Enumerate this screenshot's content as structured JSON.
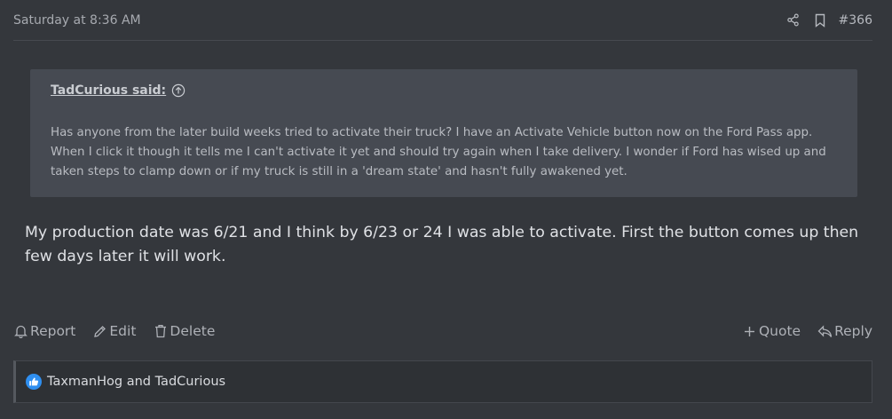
{
  "post": {
    "timestamp": "Saturday at 8:36 AM",
    "number": "#366",
    "share_icon": "share-icon",
    "bookmark_icon": "bookmark-icon"
  },
  "quote": {
    "author_label": "TadCurious said:",
    "jump_icon": "arrow-up-circle-icon",
    "text": "Has anyone from the later build weeks tried to activate their truck? I have an Activate Vehicle button now on the Ford Pass app. When I click it though it tells me I can't activate it yet and should try again when I take delivery. I wonder if Ford has wised up and taken steps to clamp down or if my truck is still in a 'dream state' and hasn't fully awakened yet."
  },
  "message": {
    "text": "My production date was 6/21 and I think by 6/23 or 24 I was able to activate. First the button comes up then few days later it will work."
  },
  "actions": {
    "report": "Report",
    "edit": "Edit",
    "delete": "Delete",
    "quote": "Quote",
    "reply": "Reply"
  },
  "reactions": {
    "icon": "like-icon",
    "users": "TaxmanHog and TadCurious"
  },
  "colors": {
    "background": "#34373c",
    "quote_bg": "#464a52",
    "like_blue": "#2f8ff0"
  }
}
